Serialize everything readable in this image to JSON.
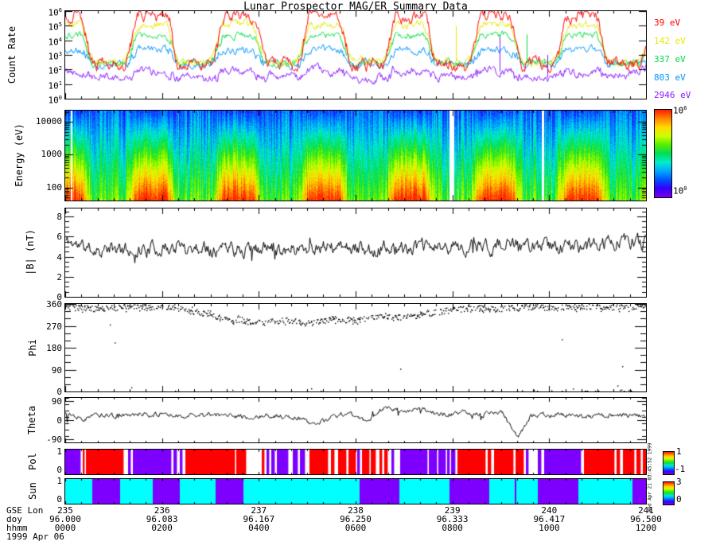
{
  "title": "Lunar Prospector MAG/ER Summary Data",
  "annotations": {
    "generated": "Wed Apr 21 03:45:52 1999"
  },
  "x_axis": {
    "rows": [
      {
        "label": "GSE Lon",
        "values": [
          "235",
          "236",
          "237",
          "238",
          "239",
          "240",
          "241"
        ]
      },
      {
        "label": "doy",
        "values": [
          "96.000",
          "96.083",
          "96.167",
          "96.250",
          "96.333",
          "96.417",
          "96.500"
        ]
      },
      {
        "label": "hhmm",
        "values": [
          "0000",
          "0200",
          "0400",
          "0600",
          "0800",
          "1000",
          "1200"
        ]
      }
    ],
    "date": "1999 Apr 06"
  },
  "segment_colors": {
    "P": "#7d00ff",
    "R": "#ff0000",
    "C": "#00ffff",
    "W": "#ffffff"
  },
  "chart_data": [
    {
      "id": "count_rate",
      "type": "line",
      "ylabel": "Count Rate",
      "yscale": "log",
      "ylim": [
        1,
        1000000
      ],
      "ytick_exponents": [
        6,
        5,
        4,
        3,
        2,
        1,
        0
      ],
      "x_range_doy": [
        96.0,
        96.5
      ],
      "wake_centers": [
        0.075,
        0.223,
        0.371,
        0.519,
        0.667,
        0.815,
        0.963
      ],
      "wake_halfwidth": 0.025,
      "wake_transition": 0.027,
      "series": [
        {
          "name": "39 eV",
          "color": "#ff0000",
          "plateau_log": 5.72,
          "wake_log": 2.35,
          "noise": 0.2
        },
        {
          "name": "142 eV",
          "color": "#e8e800",
          "plateau_log": 5.05,
          "wake_log": 2.55,
          "noise": 0.13
        },
        {
          "name": "337 eV",
          "color": "#00dd44",
          "plateau_log": 4.35,
          "wake_log": 2.45,
          "noise": 0.11
        },
        {
          "name": "803 eV",
          "color": "#0095ff",
          "plateau_log": 3.35,
          "wake_log": 2.35,
          "noise": 0.12
        },
        {
          "name": "2946 eV",
          "color": "#8a1aff",
          "plateau_log": 1.85,
          "wake_log": 1.45,
          "noise": 0.14,
          "end_rise": 9
        }
      ],
      "spikes": [
        {
          "series": 1,
          "f": 0.672,
          "to_log": 5.0
        },
        {
          "series": 2,
          "f": 0.795,
          "to_log": 4.4
        },
        {
          "series": 4,
          "f": 0.748,
          "to_log": 4.25
        },
        {
          "series": 4,
          "f": 0.83,
          "to_log": 3.0
        }
      ]
    },
    {
      "id": "spectrogram",
      "type": "heatmap",
      "ylabel": "Energy (eV)",
      "yscale": "log",
      "ylim": [
        40,
        22000
      ],
      "yticks": [
        100,
        1000,
        10000
      ],
      "colorbar": {
        "top_label_exponent": 6,
        "bottom_label_exponent": 0
      },
      "plateau_profile": {
        "bottom_log": 6.05,
        "top_log": 1.1
      },
      "wake_profile": {
        "bottom_log": 3.5,
        "top_log": 1.3
      },
      "column_noise": 0.45,
      "pixel_noise": 0.3,
      "white_stripes": [
        {
          "f": 0.01,
          "wpx": 2
        },
        {
          "f": 0.662,
          "wpx": 6
        },
        {
          "f": 0.82,
          "wpx": 3
        }
      ],
      "colormap": [
        "#7a00e6",
        "#3300ff",
        "#0055ff",
        "#00aaff",
        "#00eecc",
        "#00dd55",
        "#55ee00",
        "#ccff00",
        "#ffdd00",
        "#ff8800",
        "#ff2200"
      ]
    },
    {
      "id": "bmag",
      "type": "line",
      "ylabel": "|B| (nT)",
      "yscale": "linear",
      "ylim": [
        0,
        8.8
      ],
      "yticks": [
        0,
        2,
        4,
        6,
        8
      ],
      "yminor": 0.5,
      "color": "#000000",
      "noise": 0.5,
      "anchors": [
        [
          0,
          5.6
        ],
        [
          0.04,
          4.8
        ],
        [
          0.1,
          4.6
        ],
        [
          0.2,
          5.0
        ],
        [
          0.3,
          4.7
        ],
        [
          0.4,
          4.9
        ],
        [
          0.5,
          4.8
        ],
        [
          0.6,
          4.9
        ],
        [
          0.7,
          5.0
        ],
        [
          0.8,
          5.1
        ],
        [
          0.9,
          5.0
        ],
        [
          0.96,
          5.6
        ],
        [
          1,
          5.3
        ]
      ]
    },
    {
      "id": "phi",
      "type": "scatter",
      "ylabel": "Phi",
      "yscale": "linear",
      "ylim": [
        0,
        360
      ],
      "yticks": [
        0,
        90,
        180,
        270,
        360
      ],
      "yminor": 30,
      "color": "#000000",
      "scatter": 12,
      "anchors": [
        [
          0,
          348
        ],
        [
          0.05,
          342
        ],
        [
          0.1,
          350
        ],
        [
          0.15,
          345
        ],
        [
          0.18,
          352
        ],
        [
          0.22,
          330
        ],
        [
          0.26,
          310
        ],
        [
          0.3,
          295
        ],
        [
          0.34,
          285
        ],
        [
          0.38,
          295
        ],
        [
          0.42,
          280
        ],
        [
          0.46,
          300
        ],
        [
          0.5,
          295
        ],
        [
          0.54,
          315
        ],
        [
          0.58,
          305
        ],
        [
          0.62,
          320
        ],
        [
          0.66,
          335
        ],
        [
          0.7,
          345
        ],
        [
          0.75,
          340
        ],
        [
          0.8,
          350
        ],
        [
          0.85,
          345
        ],
        [
          0.9,
          352
        ],
        [
          0.95,
          348
        ],
        [
          1,
          352
        ]
      ]
    },
    {
      "id": "theta",
      "type": "line",
      "ylabel": "Theta",
      "yscale": "linear",
      "ylim": [
        -105,
        105
      ],
      "yticks": [
        -90,
        0,
        90
      ],
      "yminor": 30,
      "color": "#000000",
      "noise": 8,
      "anchors": [
        [
          0,
          35
        ],
        [
          0.03,
          5
        ],
        [
          0.06,
          25
        ],
        [
          0.1,
          20
        ],
        [
          0.15,
          28
        ],
        [
          0.2,
          18
        ],
        [
          0.25,
          25
        ],
        [
          0.3,
          15
        ],
        [
          0.35,
          22
        ],
        [
          0.4,
          10
        ],
        [
          0.43,
          -20
        ],
        [
          0.46,
          15
        ],
        [
          0.49,
          35
        ],
        [
          0.52,
          -10
        ],
        [
          0.55,
          70
        ],
        [
          0.58,
          40
        ],
        [
          0.61,
          55
        ],
        [
          0.64,
          25
        ],
        [
          0.68,
          35
        ],
        [
          0.72,
          25
        ],
        [
          0.75,
          40
        ],
        [
          0.78,
          -80
        ],
        [
          0.8,
          20
        ],
        [
          0.85,
          28
        ],
        [
          0.9,
          15
        ],
        [
          0.95,
          25
        ],
        [
          1,
          20
        ]
      ]
    },
    {
      "id": "pol",
      "type": "segments",
      "ylabel": "Pol",
      "ytick_labels": [
        "1",
        "0"
      ],
      "cbar_labels": [
        "1",
        "-1"
      ],
      "segments": [
        [
          "P",
          19
        ],
        [
          "W",
          3
        ],
        [
          "R",
          2
        ],
        [
          "W",
          2
        ],
        [
          "R",
          47
        ],
        [
          "W",
          6
        ],
        [
          "P",
          3
        ],
        [
          "W",
          3
        ],
        [
          "P",
          48
        ],
        [
          "W",
          3
        ],
        [
          "P",
          4
        ],
        [
          "W",
          4
        ],
        [
          "P",
          3
        ],
        [
          "W",
          4
        ],
        [
          "R",
          62
        ],
        [
          "W",
          2
        ],
        [
          "R",
          12
        ],
        [
          "W",
          20
        ],
        [
          "R",
          3
        ],
        [
          "W",
          3
        ],
        [
          "P",
          3
        ],
        [
          "W",
          3
        ],
        [
          "P",
          4
        ],
        [
          "W",
          3
        ],
        [
          "P",
          14
        ],
        [
          "W",
          6
        ],
        [
          "P",
          6
        ],
        [
          "W",
          3
        ],
        [
          "P",
          6
        ],
        [
          "W",
          6
        ],
        [
          "R",
          23
        ],
        [
          "W",
          4
        ],
        [
          "R",
          4
        ],
        [
          "W",
          5
        ],
        [
          "R",
          10
        ],
        [
          "W",
          3
        ],
        [
          "R",
          9
        ],
        [
          "W",
          2
        ],
        [
          "P",
          3
        ],
        [
          "W",
          3
        ],
        [
          "R",
          9
        ],
        [
          "W",
          2
        ],
        [
          "R",
          6
        ],
        [
          "W",
          5
        ],
        [
          "R",
          3
        ],
        [
          "W",
          3
        ],
        [
          "R",
          4
        ],
        [
          "W",
          5
        ],
        [
          "P",
          3
        ],
        [
          "W",
          8
        ],
        [
          "P",
          34
        ],
        [
          "W",
          2
        ],
        [
          "P",
          10
        ],
        [
          "W",
          2
        ],
        [
          "P",
          9
        ],
        [
          "W",
          2
        ],
        [
          "P",
          3
        ],
        [
          "W",
          2
        ],
        [
          "P",
          5
        ],
        [
          "W",
          3
        ],
        [
          "R",
          35
        ],
        [
          "W",
          3
        ],
        [
          "R",
          4
        ],
        [
          "W",
          4
        ],
        [
          "R",
          24
        ],
        [
          "W",
          3
        ],
        [
          "R",
          10
        ],
        [
          "W",
          3
        ],
        [
          "P",
          3
        ],
        [
          "W",
          12
        ],
        [
          "P",
          4
        ],
        [
          "W",
          4
        ],
        [
          "P",
          46
        ],
        [
          "W",
          4
        ],
        [
          "R",
          38
        ],
        [
          "W",
          3
        ],
        [
          "R",
          4
        ],
        [
          "W",
          4
        ],
        [
          "R",
          14
        ],
        [
          "W",
          3
        ],
        [
          "R",
          5
        ],
        [
          "W",
          3
        ],
        [
          "R",
          4
        ]
      ]
    },
    {
      "id": "sun",
      "type": "segments",
      "ylabel": "Sun",
      "ytick_labels": [
        "1",
        "0"
      ],
      "cbar_labels": [
        "3",
        "0"
      ],
      "segments": [
        [
          "C",
          34
        ],
        [
          "P",
          35
        ],
        [
          "C",
          41
        ],
        [
          "P",
          34
        ],
        [
          "C",
          45
        ],
        [
          "P",
          35
        ],
        [
          "C",
          146
        ],
        [
          "P",
          50
        ],
        [
          "C",
          63
        ],
        [
          "P",
          50
        ],
        [
          "C",
          32
        ],
        [
          "P",
          2
        ],
        [
          "C",
          27
        ],
        [
          "P",
          51
        ],
        [
          "C",
          68
        ],
        [
          "P",
          17
        ]
      ]
    }
  ]
}
